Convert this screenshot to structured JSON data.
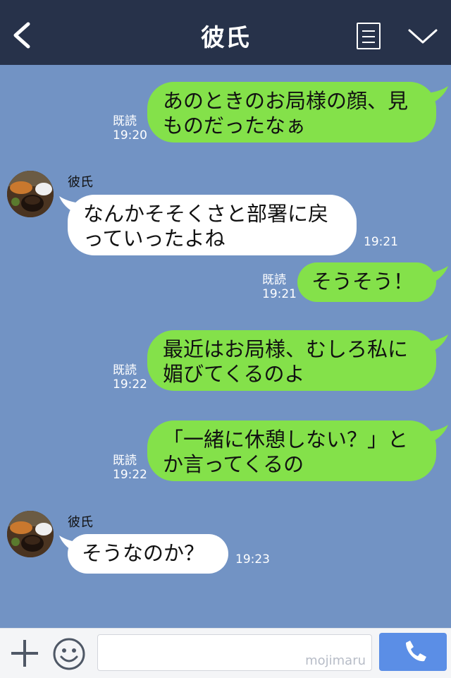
{
  "header": {
    "title": "彼氏",
    "back_icon": "back-arrow-icon",
    "menu_icon": "menu-list-icon",
    "collapse_icon": "chevron-down-icon",
    "background": "#27324a"
  },
  "chat": {
    "background": "#7293c4",
    "sent_color": "#84e14a",
    "received_color": "#ffffff",
    "messages": [
      {
        "from": "me",
        "text_lines": [
          "あのときのお局様の顔、見",
          "ものだったなぁ"
        ],
        "read": "既読",
        "time": "19:20"
      },
      {
        "from": "彼氏",
        "sender": "彼氏",
        "text_lines": [
          "なんかそそくさと部署に戻",
          "っていったよね"
        ],
        "time": "19:21"
      },
      {
        "from": "me",
        "text_lines": [
          "そうそう！"
        ],
        "read": "既読",
        "time": "19:21"
      },
      {
        "from": "me",
        "text_lines": [
          "最近はお局様、むしろ私に",
          "媚びてくるのよ"
        ],
        "read": "既読",
        "time": "19:22"
      },
      {
        "from": "me",
        "text_lines": [
          "「一緒に休憩しない？」と",
          "か言ってくるの"
        ],
        "read": "既読",
        "time": "19:22"
      },
      {
        "from": "彼氏",
        "sender": "彼氏",
        "text_lines": [
          "そうなのか？"
        ],
        "time": "19:23"
      }
    ]
  },
  "footer": {
    "plus_icon": "plus-icon",
    "sticker_icon": "smiley-icon",
    "input_value": "",
    "watermark": "mojimaru",
    "call_icon": "phone-icon",
    "call_button_color": "#5b8ee6"
  }
}
